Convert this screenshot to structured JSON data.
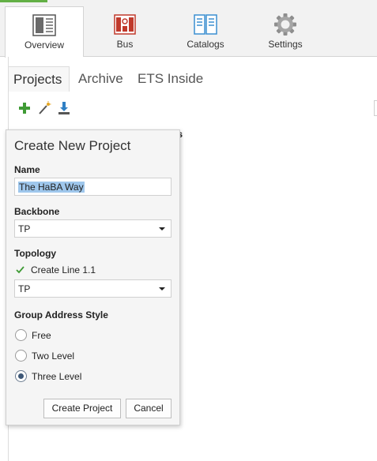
{
  "ribbon": {
    "tabs": [
      {
        "label": "Overview",
        "icon": "overview-icon"
      },
      {
        "label": "Bus",
        "icon": "bus-icon"
      },
      {
        "label": "Catalogs",
        "icon": "catalogs-icon"
      },
      {
        "label": "Settings",
        "icon": "gear-icon"
      }
    ],
    "active": "Overview",
    "accent": "#63b046"
  },
  "subtabs": [
    {
      "label": "Projects"
    },
    {
      "label": "Archive"
    },
    {
      "label": "ETS Inside"
    }
  ],
  "toolbar": {
    "icons": [
      "add-icon",
      "wizard-wand-icon",
      "import-icon"
    ],
    "colors": {
      "add": "#3f9b35",
      "import": "#2f7fc4"
    }
  },
  "list": {
    "status_header": "tus"
  },
  "dialog": {
    "title": "Create New Project",
    "name_label": "Name",
    "name_value": "The HaBA Way",
    "backbone_label": "Backbone",
    "backbone_value": "TP",
    "topology_label": "Topology",
    "create_line_label": "Create Line 1.1",
    "create_line_checked": true,
    "topology_value": "TP",
    "gas_label": "Group Address Style",
    "gas_options": [
      {
        "label": "Free",
        "selected": false
      },
      {
        "label": "Two Level",
        "selected": false
      },
      {
        "label": "Three Level",
        "selected": true
      }
    ],
    "create_button": "Create Project",
    "cancel_button": "Cancel"
  }
}
